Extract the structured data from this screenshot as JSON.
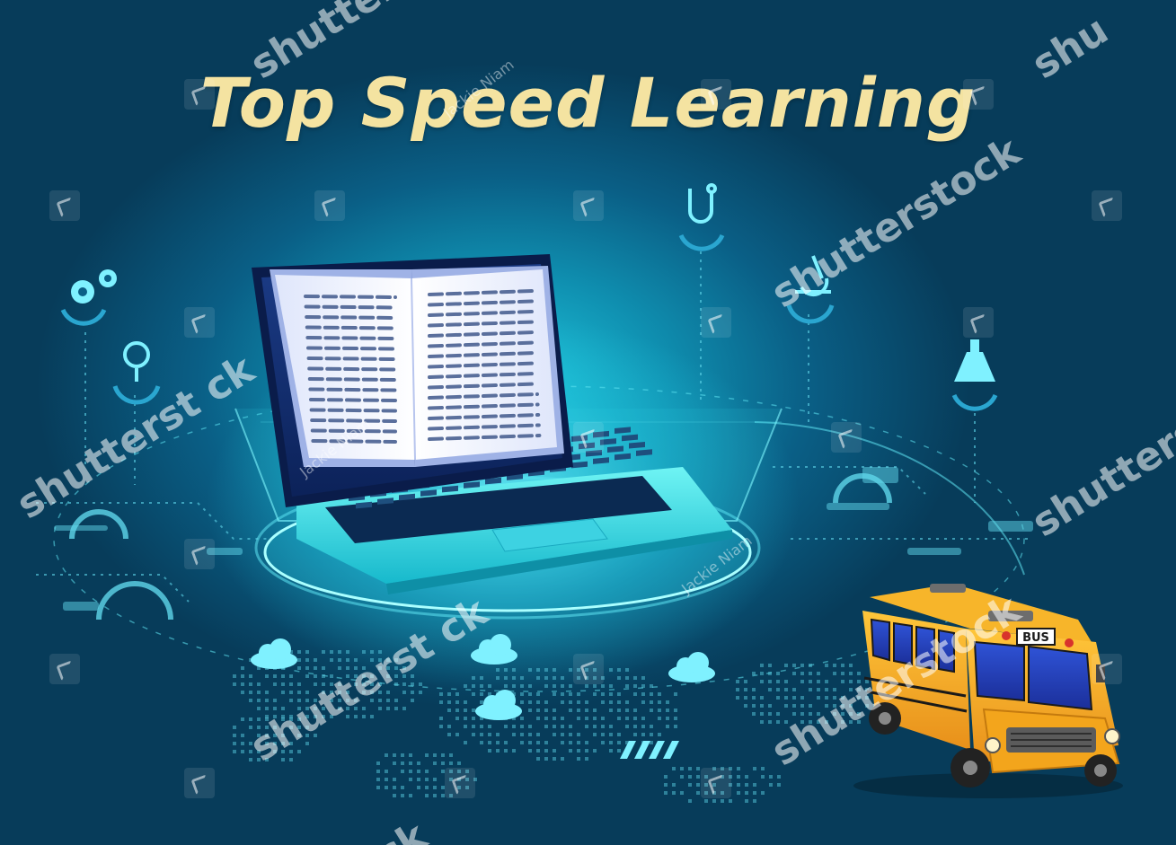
{
  "title": "Top Speed Learning",
  "watermark": {
    "shutterstock_lines": [
      "shutterstock",
      "shutterstock",
      "shutterstock",
      "shutterstock",
      "shutterstock",
      "shutterstock",
      "shutterst ck",
      "shutterst ck",
      "shutterst ck",
      "shutterst ck",
      "ck",
      "shu"
    ],
    "author": "Jackie Niam"
  },
  "bus_sign": "BUS",
  "colors": {
    "background": "#0a5f86",
    "glow": "#1fc6dc",
    "title": "#f4e3a1",
    "bus_body": "#f3a51c",
    "laptop_body": "#3fe0ea"
  },
  "icons": [
    "gears-icon",
    "lightbulb-icon",
    "stethoscope-icon",
    "microscope-icon",
    "flask-icon",
    "cloud-icon"
  ]
}
